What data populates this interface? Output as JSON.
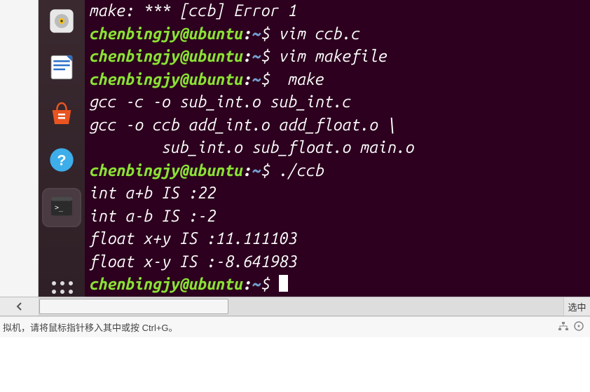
{
  "terminal": {
    "colors": {
      "bg": "#2c001e",
      "user": "#8ae234",
      "path": "#729fcf",
      "text": "#ffffff"
    },
    "prompt": {
      "user": "chenbingjy",
      "host": "ubuntu",
      "path": "~",
      "symbol": "$"
    },
    "lines": [
      {
        "type": "output",
        "text": "make: *** [ccb] Error 1"
      },
      {
        "type": "prompt",
        "cmd": "vim ccb.c"
      },
      {
        "type": "prompt",
        "cmd": "vim makefile"
      },
      {
        "type": "prompt",
        "cmd": " make"
      },
      {
        "type": "output",
        "text": "gcc -c -o sub_int.o sub_int.c"
      },
      {
        "type": "output",
        "text": "gcc -o ccb add_int.o add_float.o \\"
      },
      {
        "type": "output",
        "text": "        sub_int.o sub_float.o main.o"
      },
      {
        "type": "prompt",
        "cmd": "./ccb"
      },
      {
        "type": "output",
        "text": "int a+b IS :22"
      },
      {
        "type": "output",
        "text": "int a-b IS :-2"
      },
      {
        "type": "output",
        "text": "float x+y IS :11.111103"
      },
      {
        "type": "output",
        "text": "float x-y IS :-8.641983"
      },
      {
        "type": "prompt",
        "cmd": "",
        "cursor": true
      }
    ]
  },
  "launcher": {
    "items": [
      {
        "name": "rhythmbox-icon"
      },
      {
        "name": "libreoffice-writer-icon"
      },
      {
        "name": "ubuntu-software-icon"
      },
      {
        "name": "help-icon"
      },
      {
        "name": "terminal-icon",
        "active": true
      }
    ]
  },
  "scrollbar": {
    "right_label": "选中"
  },
  "statusbar": {
    "text": "拟机，请将鼠标指针移入其中或按 Ctrl+G。"
  }
}
